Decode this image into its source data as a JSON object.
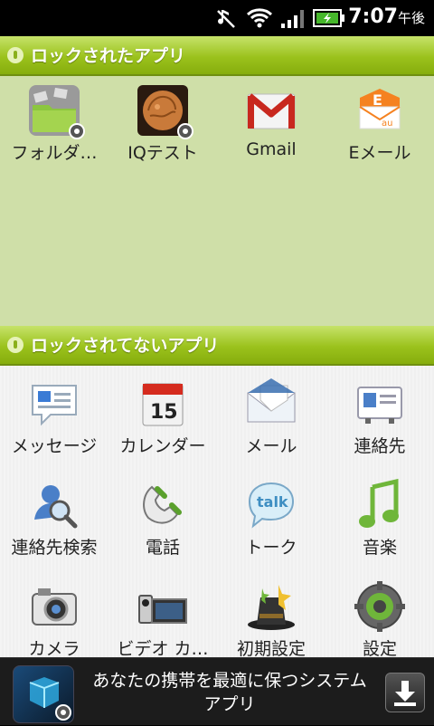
{
  "status": {
    "time": "7:07",
    "ampm": "午後"
  },
  "locked_section": {
    "title": "ロックされたアプリ",
    "apps": [
      {
        "label": "フォルダ…",
        "icon": "folder-icon"
      },
      {
        "label": "IQテスト",
        "icon": "brain-icon"
      },
      {
        "label": "Gmail",
        "icon": "gmail-icon"
      },
      {
        "label": "Eメール",
        "icon": "email-icon"
      }
    ]
  },
  "unlocked_section": {
    "title": "ロックされてないアプリ",
    "apps": [
      {
        "label": "メッセージ",
        "icon": "message-icon"
      },
      {
        "label": "カレンダー",
        "icon": "calendar-icon"
      },
      {
        "label": "メール",
        "icon": "mail-icon"
      },
      {
        "label": "連絡先",
        "icon": "contacts-icon"
      },
      {
        "label": "連絡先検索",
        "icon": "contact-search-icon"
      },
      {
        "label": "電話",
        "icon": "phone-icon"
      },
      {
        "label": "トーク",
        "icon": "talk-icon"
      },
      {
        "label": "音楽",
        "icon": "music-icon"
      },
      {
        "label": "カメラ",
        "icon": "camera-icon"
      },
      {
        "label": "ビデオ カ…",
        "icon": "video-camera-icon"
      },
      {
        "label": "初期設定",
        "icon": "magic-hat-icon"
      },
      {
        "label": "設定",
        "icon": "settings-gear-icon"
      }
    ]
  },
  "calendar_day": "15",
  "talk_text": "talk",
  "email_letter": "E",
  "email_sub": "au",
  "banner": {
    "text": "あなたの携帯を最適に保つシステムアプリ"
  }
}
